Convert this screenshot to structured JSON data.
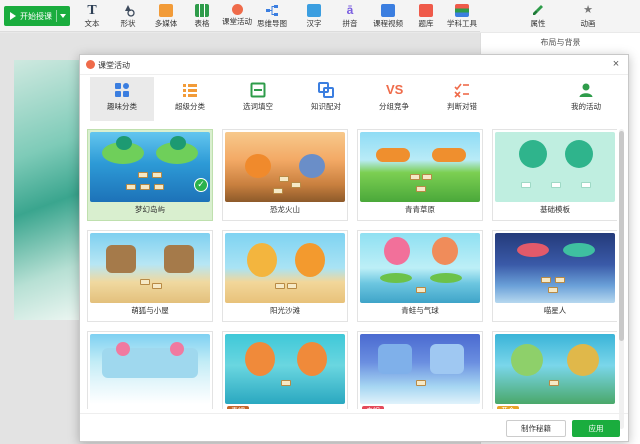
{
  "toolbar": {
    "start_label": "开始授课",
    "tools": [
      {
        "label": "文本",
        "icon": "text-icon"
      },
      {
        "label": "形状",
        "icon": "shape-icon"
      },
      {
        "label": "多媒体",
        "icon": "media-icon"
      },
      {
        "label": "表格",
        "icon": "table-icon"
      },
      {
        "label": "课堂活动",
        "icon": "activity-icon"
      },
      {
        "label": "思维导图",
        "icon": "mindmap-icon"
      },
      {
        "label": "汉字",
        "icon": "hanzi-icon"
      },
      {
        "label": "拼音",
        "icon": "pinyin-icon"
      },
      {
        "label": "课程视频",
        "icon": "video-icon"
      },
      {
        "label": "题库",
        "icon": "question-bank-icon"
      },
      {
        "label": "学科工具",
        "icon": "subject-tools-icon"
      }
    ],
    "right_tabs": [
      {
        "label": "属性",
        "icon": "brush-icon"
      },
      {
        "label": "动画",
        "icon": "star-icon"
      }
    ]
  },
  "right_panel": {
    "title": "布局与背景"
  },
  "dialog": {
    "title": "课堂活动",
    "close": "×",
    "categories": [
      {
        "label": "趣味分类",
        "icon": "grid-icon",
        "active": true
      },
      {
        "label": "超级分类",
        "icon": "list-icon",
        "active": false
      },
      {
        "label": "选词填空",
        "icon": "fill-blank-icon",
        "active": false
      },
      {
        "label": "知识配对",
        "icon": "pair-icon",
        "active": false
      },
      {
        "label": "分组竞争",
        "icon": "vs-icon",
        "active": false
      },
      {
        "label": "判断对错",
        "icon": "true-false-icon",
        "active": false
      },
      {
        "label": "我的活动",
        "icon": "user-icon",
        "active": false
      }
    ],
    "vs_text": "VS",
    "templates": [
      {
        "name": "梦幻岛屿",
        "selected": true
      },
      {
        "name": "恐龙火山",
        "selected": false
      },
      {
        "name": "青青草原",
        "selected": false
      },
      {
        "name": "基础模板",
        "selected": false
      },
      {
        "name": "萌狐与小屋",
        "selected": false
      },
      {
        "name": "阳光沙滩",
        "selected": false
      },
      {
        "name": "青蛙与气球",
        "selected": false
      },
      {
        "name": "喵星人",
        "selected": false
      },
      {
        "name": "",
        "selected": false,
        "badge": ""
      },
      {
        "name": "",
        "selected": false,
        "badge": "青铜"
      },
      {
        "name": "",
        "selected": false,
        "badge": "白银"
      },
      {
        "name": "",
        "selected": false,
        "badge": "黄金"
      }
    ],
    "footer": {
      "secret_label": "制作秘籍",
      "apply_label": "应用"
    }
  },
  "colors": {
    "accent_green": "#1aad3e",
    "vs_red": "#ef6b4a",
    "selected_card": "#d9efcf"
  }
}
